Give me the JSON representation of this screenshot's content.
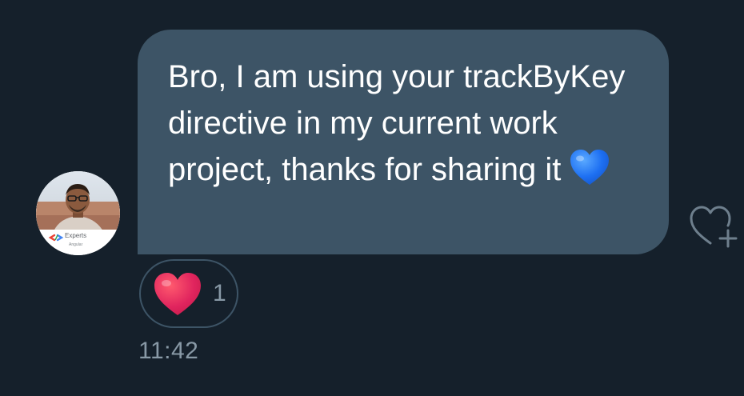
{
  "message": {
    "text": "Bro, I am using your trackByKey directive in my current work project, thanks for sharing it",
    "emoji": "blue-heart-icon"
  },
  "avatar": {
    "badge_text": "Experts",
    "badge_subtext": "Angular"
  },
  "reactions": {
    "emoji": "red-heart-icon",
    "count": "1"
  },
  "timestamp": "11:42",
  "colors": {
    "background": "#15202b",
    "bubble": "#3d5466",
    "muted_text": "#8899a6",
    "red_heart": "#e0245e",
    "blue_heart": "#1d6ff2"
  }
}
